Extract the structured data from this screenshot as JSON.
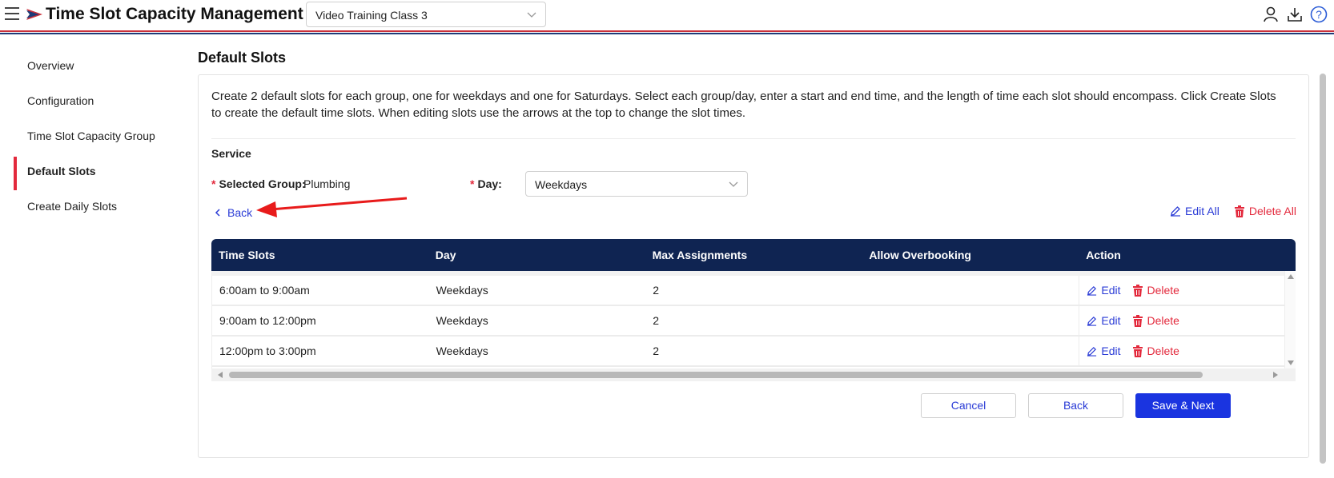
{
  "header": {
    "app_title": "Time Slot Capacity Management",
    "class_select_value": "Video Training Class 3",
    "icons": [
      "menu-icon",
      "logo-icon",
      "user-icon",
      "download-icon",
      "help-icon"
    ],
    "colors": {
      "red_stripe": "#c9303a",
      "blue_stripe": "#1f3b78"
    }
  },
  "sidebar": {
    "items": [
      {
        "label": "Overview"
      },
      {
        "label": "Configuration"
      },
      {
        "label": "Time Slot Capacity Group"
      },
      {
        "label": "Default Slots",
        "active": true
      },
      {
        "label": "Create Daily Slots"
      }
    ]
  },
  "main": {
    "title": "Default Slots",
    "intro": "Create 2 default slots for each group, one for weekdays and one for Saturdays. Select each group/day, enter a start and end time, and the length of time each slot should encompass. Click Create Slots to create the default time slots. When editing slots use the arrows at the top to change the slot times.",
    "section_label": "Service",
    "selected_group_label": "Selected Group",
    "selected_group_value": "Plumbing",
    "day_label": "Day",
    "day_value": "Weekdays",
    "back_link": "Back",
    "edit_all": "Edit All",
    "delete_all": "Delete All",
    "table": {
      "headers": [
        "Time Slots",
        "Day",
        "Max Assignments",
        "Allow Overbooking",
        "Action"
      ],
      "rows": [
        {
          "slot": "6:00am to 9:00am",
          "day": "Weekdays",
          "max": "2",
          "overbooking": ""
        },
        {
          "slot": "9:00am to 12:00pm",
          "day": "Weekdays",
          "max": "2",
          "overbooking": ""
        },
        {
          "slot": "12:00pm to 3:00pm",
          "day": "Weekdays",
          "max": "2",
          "overbooking": ""
        }
      ],
      "edit_label": "Edit",
      "delete_label": "Delete"
    },
    "buttons": {
      "cancel": "Cancel",
      "back": "Back",
      "save_next": "Save & Next"
    },
    "colors": {
      "header_bg": "#0f2452",
      "link": "#2a3bd6",
      "danger": "#e3293c",
      "primary": "#1a34e0"
    }
  }
}
